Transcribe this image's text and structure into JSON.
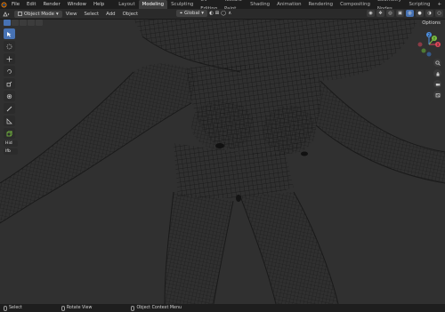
{
  "topbar": {
    "menus": [
      "File",
      "Edit",
      "Render",
      "Window",
      "Help"
    ],
    "workspaces": [
      "Layout",
      "Modeling",
      "Sculpting",
      "UV Editing",
      "Texture Paint",
      "Shading",
      "Animation",
      "Rendering",
      "Compositing",
      "Geometry Nodes",
      "Scripting"
    ],
    "active_workspace": "Modeling",
    "add_label": "+"
  },
  "header": {
    "mode": "Object Mode",
    "menus": [
      "View",
      "Select",
      "Add",
      "Object"
    ],
    "orientation": "Global"
  },
  "toolbar": {
    "tools": [
      "select-box",
      "cursor",
      "move",
      "rotate",
      "scale",
      "transform",
      "annotate",
      "measure",
      "add-cube"
    ],
    "label": "Hid",
    "label2": "Ifb"
  },
  "options": {
    "label": "Options"
  },
  "gizmo": {
    "x": "X",
    "y": "Y",
    "z": "Z"
  },
  "status": {
    "select": "Select",
    "rotate": "Rotate View",
    "context": "Object Context Menu"
  },
  "colors": {
    "accent": "#4772b3",
    "axis_x": "#e0475a",
    "axis_y": "#7ac241",
    "axis_z": "#4c8fe0",
    "viewport_bg": "#303030",
    "wire": "#141414"
  }
}
